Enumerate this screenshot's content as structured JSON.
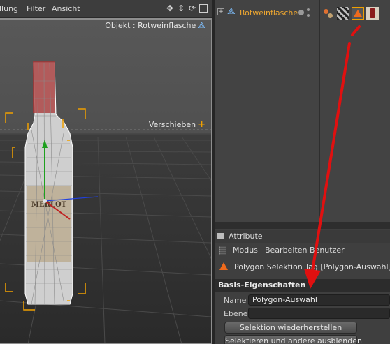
{
  "viewport": {
    "menu": [
      "llung",
      "Filter",
      "Ansicht"
    ],
    "object_label": "Objekt : Rotweinflasche",
    "tool_label": "Verschieben",
    "bottle_label_text": "MERLOT",
    "icons": [
      "move-view-icon",
      "zoom-view-icon",
      "rotate-view-icon",
      "maximize-view-icon"
    ]
  },
  "object_manager": {
    "object_name": "Rotweinflasche",
    "tags": [
      "material-sphere-tag",
      "texture-tag",
      "polygon-selection-tag",
      "bottle-texture-tag"
    ]
  },
  "attributes": {
    "title": "Attribute",
    "menu": [
      "Modus",
      "Bearbeiten",
      "Benutzer"
    ],
    "object_line": "Polygon Selektion Tag [Polygon-Auswahl]",
    "section": "Basis-Eigenschaften",
    "name_label": "Name",
    "name_value": "Polygon-Auswahl",
    "layer_label": "Ebene",
    "layer_value": "",
    "button_restore": "Selektion wiederherstellen",
    "button_hide": "Selektieren und andere ausblenden"
  },
  "colors": {
    "accent_orange": "#f0a830",
    "selection_tag_orange": "#ef6a1c",
    "annotation_red": "#e01010"
  }
}
